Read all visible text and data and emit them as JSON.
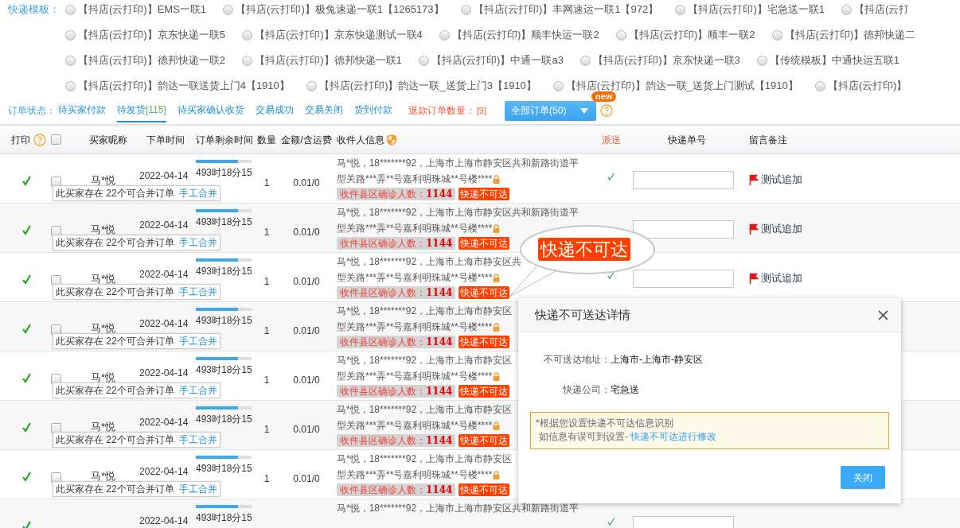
{
  "template_label": "快递模板：",
  "template_rows": [
    [
      {
        "label": "【抖店(云打印)】EMS一联1",
        "selected": false
      },
      {
        "label": "【抖店(云打印)】极兔速递一联1【1265173】",
        "selected": false
      },
      {
        "label": "【抖店(云打印)】丰网速运一联1【972】",
        "selected": false
      },
      {
        "label": "【抖店(云打印)】宅急送一联1",
        "selected": false
      },
      {
        "label": "【抖店(云打",
        "selected": false
      }
    ],
    [
      {
        "label": "【抖店(云打印)】京东快递一联5",
        "selected": false
      },
      {
        "label": "【抖店(云打印)】京东快递测试一联4",
        "selected": false
      },
      {
        "label": "【抖店(云打印)】顺丰快运一联2",
        "selected": false
      },
      {
        "label": "【抖店(云打印)】顺丰一联2",
        "selected": false
      },
      {
        "label": "【抖店(云打印)】德邦快递二",
        "selected": false
      }
    ],
    [
      {
        "label": "【抖店(云打印)】德邦快递一联2",
        "selected": false
      },
      {
        "label": "【抖店(云打印)】德邦快递一联1",
        "selected": false
      },
      {
        "label": "【抖店(云打印)】中通一联a3",
        "selected": false
      },
      {
        "label": "【抖店(云打印)】京东快递一联3",
        "selected": false
      },
      {
        "label": "【传统模板】中通快运五联1",
        "selected": false
      }
    ],
    [
      {
        "label": "【抖店(云打印)】韵达一联送货上门4【1910】",
        "selected": false
      },
      {
        "label": "【抖店(云打印)】韵达一联_送货上门3【1910】",
        "selected": false
      },
      {
        "label": "【抖店(云打印)】韵达一联_送货上门测试【1910】",
        "selected": false
      },
      {
        "label": "【抖店(云打印)】",
        "selected": false
      }
    ]
  ],
  "status_label": "订单状态：",
  "status_tabs": [
    {
      "label": "待买家付款",
      "selected": false
    },
    {
      "label": "待发货",
      "count": "[115]",
      "selected": true
    },
    {
      "label": "待买家确认收货",
      "selected": false
    },
    {
      "label": "交易成功",
      "selected": false
    },
    {
      "label": "交易关闭",
      "selected": false
    },
    {
      "label": "货到付款",
      "selected": false
    }
  ],
  "refund": {
    "label": "退款订单数量：",
    "count": "[9]"
  },
  "filter_button": {
    "label": "全部订单(50)",
    "badge": "new"
  },
  "table": {
    "columns": [
      {
        "label": "打印",
        "highlight": false
      },
      {
        "label": "买家昵称",
        "highlight": false
      },
      {
        "label": "下单时间",
        "highlight": false
      },
      {
        "label": "订单剩余时间",
        "highlight": false
      },
      {
        "label": "数量",
        "highlight": false
      },
      {
        "label": "金额/含运费",
        "highlight": false
      },
      {
        "label": "收件人信息",
        "highlight": false
      },
      {
        "label": "派送",
        "highlight": true
      },
      {
        "label": "快递单号",
        "highlight": false
      },
      {
        "label": "留言备注",
        "highlight": false
      }
    ],
    "select_all": {
      "checked": false
    },
    "rows": [
      {
        "printed": true,
        "checked": false,
        "name": "马*悦",
        "date": "2022-04-14",
        "remaining": "493时18分15",
        "level": 0.75,
        "qty": "1",
        "amount": "0.01/0",
        "address_lines": [
          "马*悦，18*******92，上海市上海市静安区共和新路街道平",
          "型关路***弄**号嘉利明珠城**号楼****"
        ],
        "zone_tag": {
          "label": "收件县区确诊人数：",
          "value": "1144"
        },
        "unreachable_tag": "快递不可达",
        "merge_note": {
          "text": "此买家存在 22个可合并订单",
          "link": "手工合并"
        },
        "dispatched": true,
        "tracking_field": true,
        "note": "测试追加"
      },
      {
        "printed": true,
        "checked": false,
        "name": "马*悦",
        "date": "2022-04-14",
        "remaining": "493时18分15",
        "level": 0.75,
        "qty": "1",
        "amount": "0.01/0",
        "address_lines": [
          "马*悦，18*******92，上海市上海市静安区共和新路街道平",
          "型关路***弄**号嘉利明珠城**号楼****"
        ],
        "zone_tag": {
          "label": "收件县区确诊人数：",
          "value": "1144"
        },
        "unreachable_tag": "快递不可达",
        "merge_note": {
          "text": "此买家存在 22个可合并订单",
          "link": "手工合并"
        },
        "tracking_field": true,
        "note": "测试追加"
      },
      {
        "printed": true,
        "checked": false,
        "name": "马*悦",
        "date": "2022-04-14",
        "remaining": "493时18分15",
        "level": 0.75,
        "qty": "1",
        "amount": "0.01/0",
        "address_lines": [
          "马*悦，18*******92，上海市上海市静安区共",
          "型关路***弄**号嘉利明珠城**号楼****"
        ],
        "zone_tag": {
          "label": "收件县区确诊人数：",
          "value": "1144"
        },
        "unreachable_tag": "快递不可达",
        "merge_note": {
          "text": "此买家存在 22个可合并订单",
          "link": "手工合并"
        },
        "dispatched": true,
        "tracking_field": true,
        "note": "测试追加"
      },
      {
        "printed": true,
        "checked": false,
        "name": "马*悦",
        "date": "2022-04-14",
        "remaining": "493时18分15",
        "level": 0.75,
        "qty": "1",
        "amount": "0.01/0",
        "address_lines": [
          "马*悦，18*******92，上海市上海市静安区",
          "型关路***弄**号嘉利明珠城**号楼****"
        ],
        "zone_tag": {
          "label": "收件县区确诊人数：",
          "value": "1144"
        },
        "unreachable_tag": "快递不可达",
        "merge_note": {
          "text": "此买家存在 22个可合并订单",
          "link": "手工合并"
        }
      },
      {
        "printed": true,
        "checked": false,
        "name": "马*悦",
        "date": "2022-04-14",
        "remaining": "493时18分15",
        "level": 0.75,
        "qty": "1",
        "amount": "0.01/0",
        "address_lines": [
          "马*悦，18*******92，上海市上海市静安区",
          "型关路***弄**号嘉利明珠城**号楼****"
        ],
        "zone_tag": {
          "label": "收件县区确诊人数：",
          "value": "1144"
        },
        "unreachable_tag": "快递不可达",
        "merge_note": {
          "text": "此买家存在 22个可合并订单",
          "link": "手工合并"
        }
      },
      {
        "printed": true,
        "checked": false,
        "name": "马*悦",
        "date": "2022-04-14",
        "remaining": "493时18分15",
        "level": 0.75,
        "qty": "1",
        "amount": "0.01/0",
        "address_lines": [
          "马*悦，18*******92，上海市上海市静安区",
          "型关路***弄**号嘉利明珠城**号楼****"
        ],
        "zone_tag": {
          "label": "收件县区确诊人数：",
          "value": "1144"
        },
        "unreachable_tag": "快递不可达",
        "merge_note": {
          "text": "此买家存在 22个可合并订单",
          "link": "手工合并"
        }
      },
      {
        "printed": true,
        "checked": false,
        "name": "马*悦",
        "date": "2022-04-14",
        "remaining": "493时18分15",
        "level": 0.75,
        "qty": "1",
        "amount": "0.01/0",
        "address_lines": [
          "马*悦，18*******92，上海市上海市静安区",
          "型关路***弄**号嘉利明珠城**号楼****"
        ],
        "zone_tag": {
          "label": "收件县区确诊人数：",
          "value": "1144"
        },
        "unreachable_tag": "快递不可达",
        "merge_note": {
          "text": "此买家存在 22个可合并订单",
          "link": "手工合并"
        }
      },
      {
        "printed": true,
        "date": "2022-04-14",
        "remaining": "493时18分15",
        "level": 0.75,
        "address_lines": [
          "马*悦，18*******92，上海市上海市静安区共和新路街道平"
        ],
        "dispatched": true,
        "tracking_field": true
      }
    ]
  },
  "callout": {
    "label": "快递不可达"
  },
  "dialog": {
    "title": "快递不可送达详情",
    "fields": [
      {
        "label": "不可送达地址：",
        "value": "上海市-上海市-静安区"
      },
      {
        "label": "快递公司：",
        "value": "宅急送"
      }
    ],
    "notice": {
      "line_1": "*根据您设置快递不可达信息识别",
      "line_2": "如信息有误可到设置-",
      "link": "快递不可达进行修改"
    },
    "button": "关闭"
  }
}
